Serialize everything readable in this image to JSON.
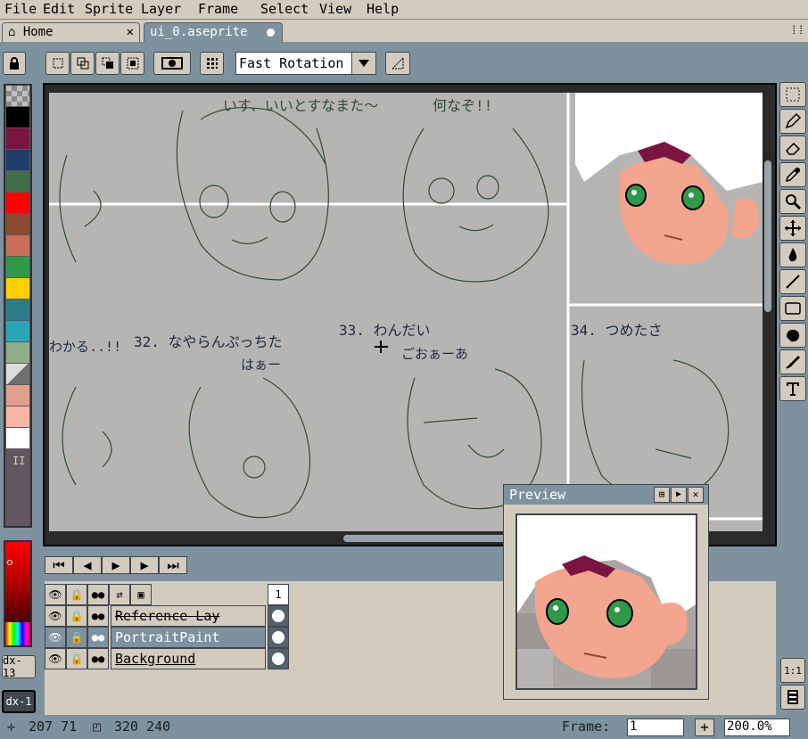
{
  "menu": [
    "File",
    "Edit",
    "Sprite",
    "Layer",
    "Frame",
    "Select",
    "View",
    "Help"
  ],
  "tabs": {
    "home": "Home",
    "file": "ui_0.aseprite"
  },
  "toolbar": {
    "rotation_algorithm": "Fast Rotation"
  },
  "sketch_text": {
    "n32": "32. なやらんぷっちた",
    "n33": "33. わんだい",
    "n34": "34. つめたさ",
    "top_left": "いす、いいとすなまた〜",
    "top_right": "何なぞ!!",
    "mid": "ごおぁーあ",
    "mid2": "はぁー",
    "left": "わかる..!!"
  },
  "palette": [
    "#8a8a8a",
    "#000000",
    "#7a1440",
    "#1c3f6e",
    "#3f6e4a",
    "#ff0000",
    "#8a4a30",
    "#c86e5a",
    "#2e9a48",
    "#ffcf00",
    "#2f7a8a",
    "#2aa6b8",
    "#90ae88",
    "#6e6e6e",
    "#e0a090",
    "#f7b6a6",
    "#ffffff"
  ],
  "palette_labels": [
    "II"
  ],
  "side_buttons": {
    "dx13": "dx-13",
    "dx1": "dx-1"
  },
  "timeline": {
    "frame_number": "1",
    "layers": [
      {
        "name": "Reference Lay",
        "strike": true
      },
      {
        "name": "PortraitPaint",
        "selected": true
      },
      {
        "name": "Background",
        "underline": true
      }
    ]
  },
  "preview": {
    "title": "Preview"
  },
  "status": {
    "cursor": "207 71",
    "size": "320 240",
    "frame_label": "Frame:",
    "frame_value": "1",
    "zoom": "200.0%"
  },
  "colors": {
    "chrome": "#d3cbbe",
    "bg": "#7d929e",
    "canvas": "#b7b5b3",
    "accent": "#56616c"
  }
}
